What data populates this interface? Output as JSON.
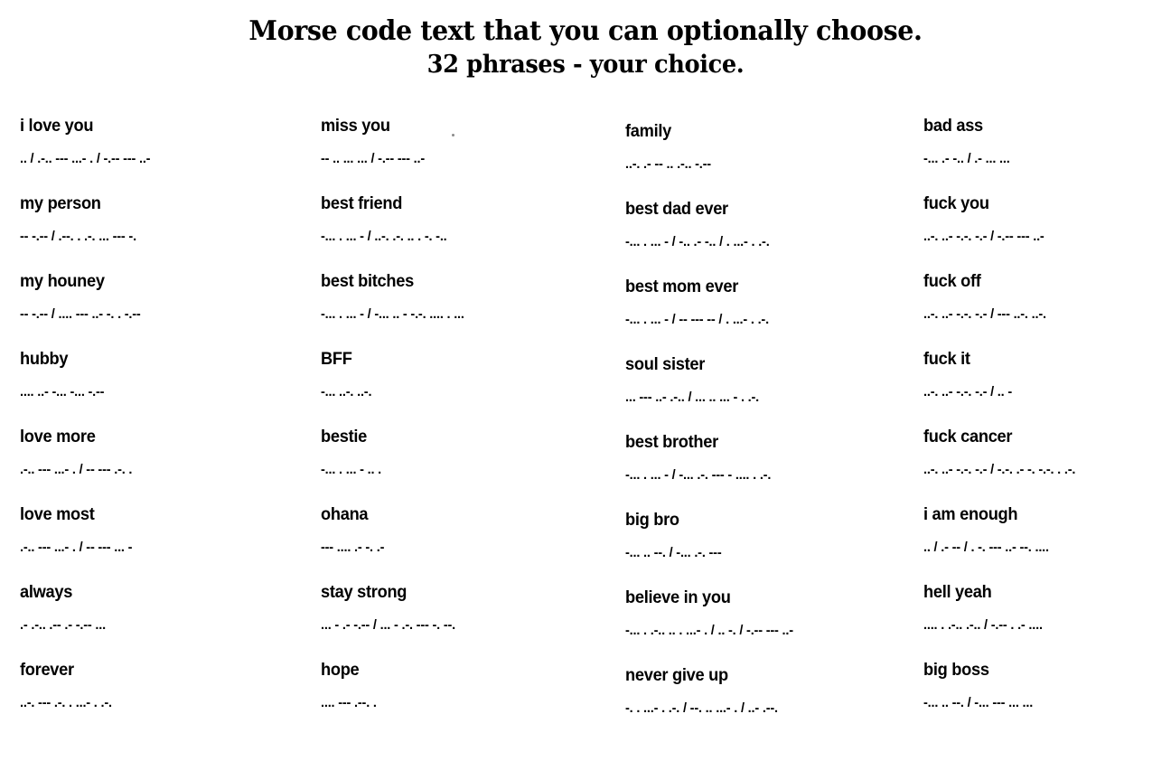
{
  "title": {
    "line1": "Morse code text that you can optionally choose.",
    "line2": "32 phrases - your choice."
  },
  "columns": [
    {
      "id": "column-1",
      "entries": [
        {
          "phrase": "i love you",
          "morse": ".. / .-.. --- ...- . / -.-- --- ..-"
        },
        {
          "phrase": "my person",
          "morse": "-- -.-- / .--. . .-. ... --- -."
        },
        {
          "phrase": "my houney",
          "morse": "-- -.-- / .... --- ..- -. . -.--"
        },
        {
          "phrase": "hubby",
          "morse": ".... ..- -... -... -.--"
        },
        {
          "phrase": "love more",
          "morse": ".-.. --- ...- . / -- --- .-. ."
        },
        {
          "phrase": "love most",
          "morse": ".-.. --- ...- . / -- --- ... -"
        },
        {
          "phrase": "always",
          "morse": ".- .-.. .-- .- -.-- ..."
        },
        {
          "phrase": "forever",
          "morse": "..-. --- .-. . ...- . .-."
        }
      ]
    },
    {
      "id": "column-2",
      "entries": [
        {
          "phrase": "miss you",
          "morse": "-- .. ... ... / -.-- --- ..-"
        },
        {
          "phrase": "best friend",
          "morse": "-... . ... - / ..-. .-. .. . -. -.."
        },
        {
          "phrase": "best bitches",
          "morse": "-... . ... - / -... .. - -.-. .... . ..."
        },
        {
          "phrase": "BFF",
          "morse": "-... ..-. ..-."
        },
        {
          "phrase": "bestie",
          "morse": "-... . ... - .. ."
        },
        {
          "phrase": "ohana",
          "morse": "--- .... .- -. .-"
        },
        {
          "phrase": "stay strong",
          "morse": "... - .- -.-- / ... - .-. --- -. --."
        },
        {
          "phrase": "hope",
          "morse": ".... --- .--. ."
        }
      ]
    },
    {
      "id": "column-3",
      "entries": [
        {
          "phrase": "family",
          "morse": "..-. .- -- .. .-.. -.--"
        },
        {
          "phrase": "best dad ever",
          "morse": "-... . ... - / -.. .- -.. / . ...- . .-."
        },
        {
          "phrase": "best mom ever",
          "morse": "-... . ... - / -- --- -- / . ...- . .-."
        },
        {
          "phrase": "soul sister",
          "morse": "... --- ..- .-.. / ... .. ... - . .-."
        },
        {
          "phrase": "best brother",
          "morse": "-... . ... - / -... .-. --- - .... . .-."
        },
        {
          "phrase": "big bro",
          "morse": "-... .. --. / -... .-. ---"
        },
        {
          "phrase": "believe in you",
          "morse": "-... . .-.. .. . ...- . / .. -. / -.-- --- ..-"
        },
        {
          "phrase": "never give up",
          "morse": "-. . ...- . .-. / --. .. ...- . / ..- .--."
        }
      ]
    },
    {
      "id": "column-4",
      "entries": [
        {
          "phrase": "bad ass",
          "morse": "-... .- -.. / .- ... ..."
        },
        {
          "phrase": "fuck you",
          "morse": "..-. ..- -.-. -.- / -.-- --- ..-"
        },
        {
          "phrase": "fuck off",
          "morse": "..-. ..- -.-. -.- / --- ..-. ..-."
        },
        {
          "phrase": "fuck it",
          "morse": "..-. ..- -.-. -.- / .. -"
        },
        {
          "phrase": "fuck cancer",
          "morse": "..-. ..- -.-. -.- / -.-. .- -. -.-. . .-."
        },
        {
          "phrase": "i am enough",
          "morse": ".. / .- -- / . -. --- ..- --. ...."
        },
        {
          "phrase": "hell yeah",
          "morse": ".... . .-.. .-.. / -.-- . .- ...."
        },
        {
          "phrase": "big boss",
          "morse": "-... .. --. / -... --- ... ..."
        }
      ]
    }
  ]
}
